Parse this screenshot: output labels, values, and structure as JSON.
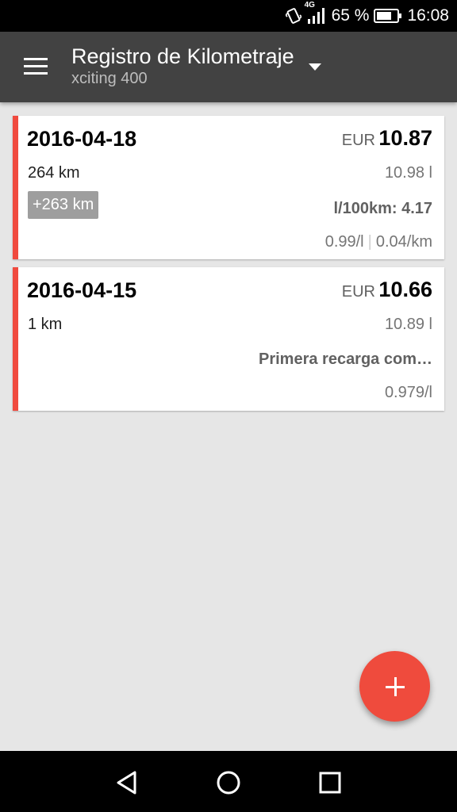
{
  "status_bar": {
    "network": "4G",
    "battery_percent": "65 %",
    "time": "16:08",
    "icons": [
      "vibrate-icon",
      "signal-icon",
      "battery-icon"
    ]
  },
  "app_bar": {
    "title": "Registro de Kilometraje",
    "subtitle": "xciting 400",
    "icons": [
      "menu-icon",
      "dropdown-caret-icon"
    ]
  },
  "entries": [
    {
      "date": "2016-04-18",
      "currency": "EUR",
      "total": "10.87",
      "odometer": "264 km",
      "liters": "10.98 l",
      "distance_diff": "+263 km",
      "consumption": "l/100km: 4.17",
      "price_per_liter": "0.99/l",
      "price_separator": "|",
      "price_per_km": "0.04/km"
    },
    {
      "date": "2016-04-15",
      "currency": "EUR",
      "total": "10.66",
      "odometer": "1 km",
      "liters": "10.89 l",
      "note": "Primera recarga com…",
      "price_per_liter": "0.979/l"
    }
  ],
  "fab": {
    "icon": "add-icon"
  },
  "colors": {
    "accent": "#ef4b3d",
    "app_bar": "#424242",
    "background": "#e6e6e6",
    "badge": "#9e9e9e"
  },
  "nav_bar": {
    "icons": [
      "back-icon",
      "home-icon",
      "recents-icon"
    ]
  }
}
